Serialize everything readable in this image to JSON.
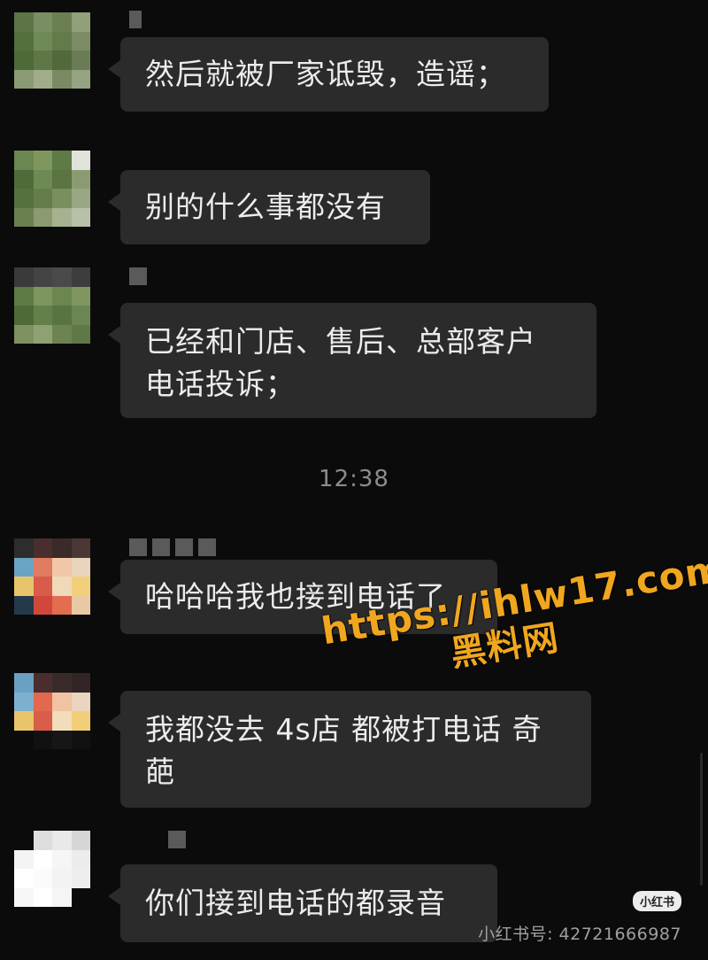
{
  "messages": [
    {
      "text": "然后就被厂家诋毁，造谣；"
    },
    {
      "text": "别的什么事都没有"
    },
    {
      "text": "已经和门店、售后、总部客户\n电话投诉；"
    },
    {
      "text": "哈哈哈我也接到电话了"
    },
    {
      "text": "我都没去 4s店 都被打电话 奇\n葩"
    },
    {
      "text": "你们接到电话的都录音"
    }
  ],
  "timestamp": "12:38",
  "watermark": {
    "url": "https://ihlw17.com",
    "name": "黑料网"
  },
  "footer": {
    "badge": "小红书",
    "id": "小红书号: 42721666987"
  },
  "colors": {
    "background": "#0b0b0b",
    "bubble": "#2b2b2b",
    "watermark": "#f0a61f"
  }
}
